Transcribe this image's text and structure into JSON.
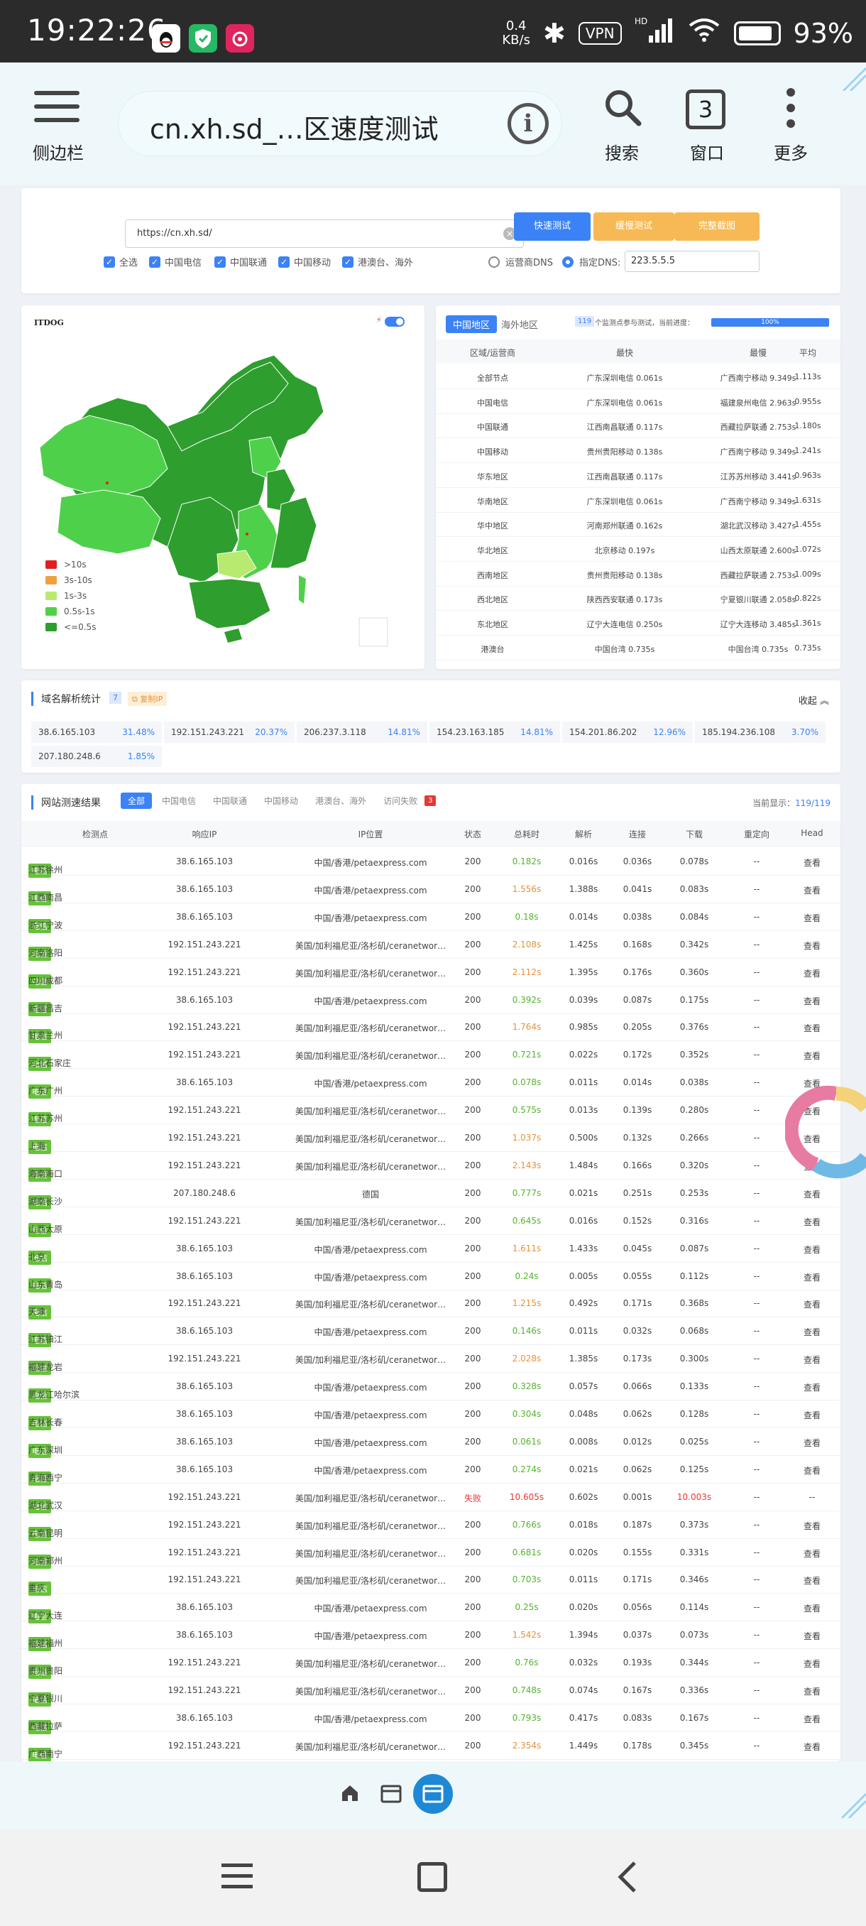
{
  "status": {
    "time": "19:22:26",
    "speed": "0.4\nKB/s",
    "vpn": "VPN",
    "hd": "HD",
    "battery": "93%"
  },
  "toolbar": {
    "sidebar": "侧边栏",
    "url": "cn.xh.sd_…区速度测试",
    "search": "搜索",
    "window": "窗口",
    "tabs": "3",
    "more": "更多"
  },
  "test": {
    "url": "https://cn.xh.sd/",
    "quick": "快速测试",
    "slow": "缓慢测试",
    "shot": "完整截图",
    "checks": [
      "全选",
      "中国电信",
      "中国联通",
      "中国移动",
      "港澳台、海外"
    ],
    "dns_isp": "运营商DNS",
    "dns_custom": "指定DNS:",
    "dns_value": "223.5.5.5"
  },
  "map": {
    "logo": "ITDOG",
    "legend": [
      {
        "label": ">10s",
        "color": "#e02020"
      },
      {
        "label": "3s-10s",
        "color": "#f0a040"
      },
      {
        "label": "1s-3s",
        "color": "#b8ea70"
      },
      {
        "label": "0.5s-1s",
        "color": "#4fd04a"
      },
      {
        "label": "<=0.5s",
        "color": "#2e9e2e"
      }
    ]
  },
  "stats": {
    "tab_cn": "中国地区",
    "tab_os": "海外地区",
    "count": "119",
    "note": "个监测点参与测试，当前进度：",
    "progress": "100%",
    "headers": [
      "区域/运营商",
      "最快",
      "最慢",
      "平均"
    ],
    "rows": [
      [
        "全部节点",
        "广东深圳电信 0.061s",
        "广西南宁移动 9.349s",
        "1.113s"
      ],
      [
        "中国电信",
        "广东深圳电信 0.061s",
        "福建泉州电信 2.963s",
        "0.955s"
      ],
      [
        "中国联通",
        "江西南昌联通 0.117s",
        "西藏拉萨联通 2.753s",
        "1.180s"
      ],
      [
        "中国移动",
        "贵州贵阳移动 0.138s",
        "广西南宁移动 9.349s",
        "1.241s"
      ],
      [
        "华东地区",
        "江西南昌联通 0.117s",
        "江苏苏州移动 3.441s",
        "0.963s"
      ],
      [
        "华南地区",
        "广东深圳电信 0.061s",
        "广西南宁移动 9.349s",
        "1.631s"
      ],
      [
        "华中地区",
        "河南郑州联通 0.162s",
        "湖北武汉移动 3.427s",
        "1.455s"
      ],
      [
        "华北地区",
        "北京移动 0.197s",
        "山西太原联通 2.600s",
        "1.072s"
      ],
      [
        "西南地区",
        "贵州贵阳移动 0.138s",
        "西藏拉萨联通 2.753s",
        "1.009s"
      ],
      [
        "西北地区",
        "陕西西安联通 0.173s",
        "宁夏银川联通 2.058s",
        "0.822s"
      ],
      [
        "东北地区",
        "辽宁大连电信 0.250s",
        "辽宁大连移动 3.485s",
        "1.361s"
      ],
      [
        "港澳台",
        "中国台湾 0.735s",
        "中国台湾 0.735s",
        "0.735s"
      ]
    ]
  },
  "dns": {
    "title": "域名解析统计",
    "count": "7",
    "copy": "复制IP",
    "collapse": "收起",
    "items": [
      [
        "38.6.165.103",
        "31.48%"
      ],
      [
        "192.151.243.221",
        "20.37%"
      ],
      [
        "206.237.3.118",
        "14.81%"
      ],
      [
        "154.23.163.185",
        "14.81%"
      ],
      [
        "154.201.86.202",
        "12.96%"
      ],
      [
        "185.194.236.108",
        "3.70%"
      ],
      [
        "207.180.248.6",
        "1.85%"
      ]
    ]
  },
  "results": {
    "title": "网站测速结果",
    "tabs": [
      "全部",
      "中国电信",
      "中国联通",
      "中国移动",
      "港澳台、海外",
      "访问失败"
    ],
    "fail": "3",
    "shown_label": "当前显示：",
    "shown": "119/119",
    "headers": [
      "检测点",
      "响应IP",
      "IP位置",
      "状态",
      "总耗时",
      "解析",
      "连接",
      "下载",
      "重定向",
      "Head"
    ],
    "isp": "电信",
    "view": "查看",
    "rows": [
      [
        "江苏徐州",
        "38.6.165.103",
        "中国/香港/petaexpress.com",
        "200",
        "0.182s",
        "0.016s",
        "0.036s",
        "0.078s",
        "--"
      ],
      [
        "江西南昌",
        "38.6.165.103",
        "中国/香港/petaexpress.com",
        "200",
        "1.556s",
        "1.388s",
        "0.041s",
        "0.083s",
        "--"
      ],
      [
        "浙江宁波",
        "38.6.165.103",
        "中国/香港/petaexpress.com",
        "200",
        "0.18s",
        "0.014s",
        "0.038s",
        "0.084s",
        "--"
      ],
      [
        "河南洛阳",
        "192.151.243.221",
        "美国/加利福尼亚/洛杉矶/ceranetwor…",
        "200",
        "2.108s",
        "1.425s",
        "0.168s",
        "0.342s",
        "--"
      ],
      [
        "四川成都",
        "192.151.243.221",
        "美国/加利福尼亚/洛杉矶/ceranetwor…",
        "200",
        "2.112s",
        "1.395s",
        "0.176s",
        "0.360s",
        "--"
      ],
      [
        "新疆昌吉",
        "38.6.165.103",
        "中国/香港/petaexpress.com",
        "200",
        "0.392s",
        "0.039s",
        "0.087s",
        "0.175s",
        "--"
      ],
      [
        "甘肃兰州",
        "192.151.243.221",
        "美国/加利福尼亚/洛杉矶/ceranetwor…",
        "200",
        "1.764s",
        "0.985s",
        "0.205s",
        "0.376s",
        "--"
      ],
      [
        "河北石家庄",
        "192.151.243.221",
        "美国/加利福尼亚/洛杉矶/ceranetwor…",
        "200",
        "0.721s",
        "0.022s",
        "0.172s",
        "0.352s",
        "--"
      ],
      [
        "广东广州",
        "38.6.165.103",
        "中国/香港/petaexpress.com",
        "200",
        "0.078s",
        "0.011s",
        "0.014s",
        "0.038s",
        "--"
      ],
      [
        "江苏苏州",
        "192.151.243.221",
        "美国/加利福尼亚/洛杉矶/ceranetwor…",
        "200",
        "0.575s",
        "0.013s",
        "0.139s",
        "0.280s",
        "--"
      ],
      [
        "上海",
        "192.151.243.221",
        "美国/加利福尼亚/洛杉矶/ceranetwor…",
        "200",
        "1.037s",
        "0.500s",
        "0.132s",
        "0.266s",
        "--"
      ],
      [
        "海南海口",
        "192.151.243.221",
        "美国/加利福尼亚/洛杉矶/ceranetwor…",
        "200",
        "2.143s",
        "1.484s",
        "0.166s",
        "0.320s",
        "--"
      ],
      [
        "湖南长沙",
        "207.180.248.6",
        "德国",
        "200",
        "0.777s",
        "0.021s",
        "0.251s",
        "0.253s",
        "--"
      ],
      [
        "山西太原",
        "192.151.243.221",
        "美国/加利福尼亚/洛杉矶/ceranetwor…",
        "200",
        "0.645s",
        "0.016s",
        "0.152s",
        "0.316s",
        "--"
      ],
      [
        "北京",
        "38.6.165.103",
        "中国/香港/petaexpress.com",
        "200",
        "1.611s",
        "1.433s",
        "0.045s",
        "0.087s",
        "--"
      ],
      [
        "山东青岛",
        "38.6.165.103",
        "中国/香港/petaexpress.com",
        "200",
        "0.24s",
        "0.005s",
        "0.055s",
        "0.112s",
        "--"
      ],
      [
        "天津",
        "192.151.243.221",
        "美国/加利福尼亚/洛杉矶/ceranetwor…",
        "200",
        "1.215s",
        "0.492s",
        "0.171s",
        "0.368s",
        "--"
      ],
      [
        "江苏镇江",
        "38.6.165.103",
        "中国/香港/petaexpress.com",
        "200",
        "0.146s",
        "0.011s",
        "0.032s",
        "0.068s",
        "--"
      ],
      [
        "福建龙岩",
        "192.151.243.221",
        "美国/加利福尼亚/洛杉矶/ceranetwor…",
        "200",
        "2.028s",
        "1.385s",
        "0.173s",
        "0.300s",
        "--"
      ],
      [
        "黑龙江哈尔滨",
        "38.6.165.103",
        "中国/香港/petaexpress.com",
        "200",
        "0.328s",
        "0.057s",
        "0.066s",
        "0.133s",
        "--"
      ],
      [
        "吉林长春",
        "38.6.165.103",
        "中国/香港/petaexpress.com",
        "200",
        "0.304s",
        "0.048s",
        "0.062s",
        "0.128s",
        "--"
      ],
      [
        "广东深圳",
        "38.6.165.103",
        "中国/香港/petaexpress.com",
        "200",
        "0.061s",
        "0.008s",
        "0.012s",
        "0.025s",
        "--"
      ],
      [
        "青海西宁",
        "38.6.165.103",
        "中国/香港/petaexpress.com",
        "200",
        "0.274s",
        "0.021s",
        "0.062s",
        "0.125s",
        "--"
      ],
      [
        "湖北武汉",
        "192.151.243.221",
        "美国/加利福尼亚/洛杉矶/ceranetwor…",
        "失败",
        "10.605s",
        "0.602s",
        "0.001s",
        "10.003s",
        "--"
      ],
      [
        "云南昆明",
        "192.151.243.221",
        "美国/加利福尼亚/洛杉矶/ceranetwor…",
        "200",
        "0.766s",
        "0.018s",
        "0.187s",
        "0.373s",
        "--"
      ],
      [
        "河南郑州",
        "192.151.243.221",
        "美国/加利福尼亚/洛杉矶/ceranetwor…",
        "200",
        "0.681s",
        "0.020s",
        "0.155s",
        "0.331s",
        "--"
      ],
      [
        "重庆",
        "192.151.243.221",
        "美国/加利福尼亚/洛杉矶/ceranetwor…",
        "200",
        "0.703s",
        "0.011s",
        "0.171s",
        "0.346s",
        "--"
      ],
      [
        "辽宁大连",
        "38.6.165.103",
        "中国/香港/petaexpress.com",
        "200",
        "0.25s",
        "0.020s",
        "0.056s",
        "0.114s",
        "--"
      ],
      [
        "福建福州",
        "38.6.165.103",
        "中国/香港/petaexpress.com",
        "200",
        "1.542s",
        "1.394s",
        "0.037s",
        "0.073s",
        "--"
      ],
      [
        "贵州贵阳",
        "192.151.243.221",
        "美国/加利福尼亚/洛杉矶/ceranetwor…",
        "200",
        "0.76s",
        "0.032s",
        "0.193s",
        "0.344s",
        "--"
      ],
      [
        "宁夏银川",
        "192.151.243.221",
        "美国/加利福尼亚/洛杉矶/ceranetwor…",
        "200",
        "0.748s",
        "0.074s",
        "0.167s",
        "0.336s",
        "--"
      ],
      [
        "西藏拉萨",
        "38.6.165.103",
        "中国/香港/petaexpress.com",
        "200",
        "0.793s",
        "0.417s",
        "0.083s",
        "0.167s",
        "--"
      ],
      [
        "广西南宁",
        "192.151.243.221",
        "美国/加利福尼亚/洛杉矶/ceranetwor…",
        "200",
        "2.354s",
        "1.449s",
        "0.178s",
        "0.345s",
        "--"
      ]
    ]
  }
}
